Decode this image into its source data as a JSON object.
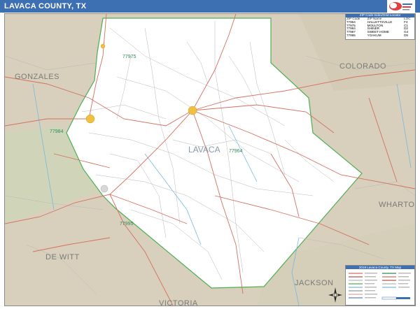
{
  "title": "LAVACA COUNTY, TX",
  "county_labels": {
    "gonzales": "GONZALES",
    "colorado": "COLORADO",
    "wharton": "WHARTON",
    "de_witt": "DE WITT",
    "jackson": "JACKSON",
    "victoria": "VICTORIA",
    "lavaca": "LAVACA"
  },
  "zip_labels": {
    "z77975": "77975",
    "z77964": "77964",
    "z77984": "77984",
    "z77995": "77995"
  },
  "zip_table": {
    "header": "ZIP Code Index/Grid Locator",
    "columns": [
      "ZIP Code",
      "ZIP Name",
      "LOC"
    ],
    "rows": [
      [
        "77964",
        "HALLETTSVILLE",
        "F4"
      ],
      [
        "77975",
        "MOULTON",
        "C1"
      ],
      [
        "77984",
        "SHINER",
        "D2"
      ],
      [
        "77987",
        "SWEET HOME",
        "G4"
      ],
      [
        "77995",
        "YOAKUM",
        "D5"
      ]
    ]
  },
  "legend": {
    "header": "2018 Lavaca County, TX Map"
  },
  "colors": {
    "title_bar": "#3d6fb3",
    "outside_land": "#d8d0bc",
    "county_fill": "#ffffff",
    "county_border": "#4caf50",
    "highway": "#e07060",
    "major_road": "#c05050",
    "minor_road": "#b8b8b8",
    "river": "#7ab8e0",
    "city": "#f0c040"
  },
  "icons": {
    "north_arrow": "compass-north-icon",
    "logo": "brand-logo-icon"
  }
}
